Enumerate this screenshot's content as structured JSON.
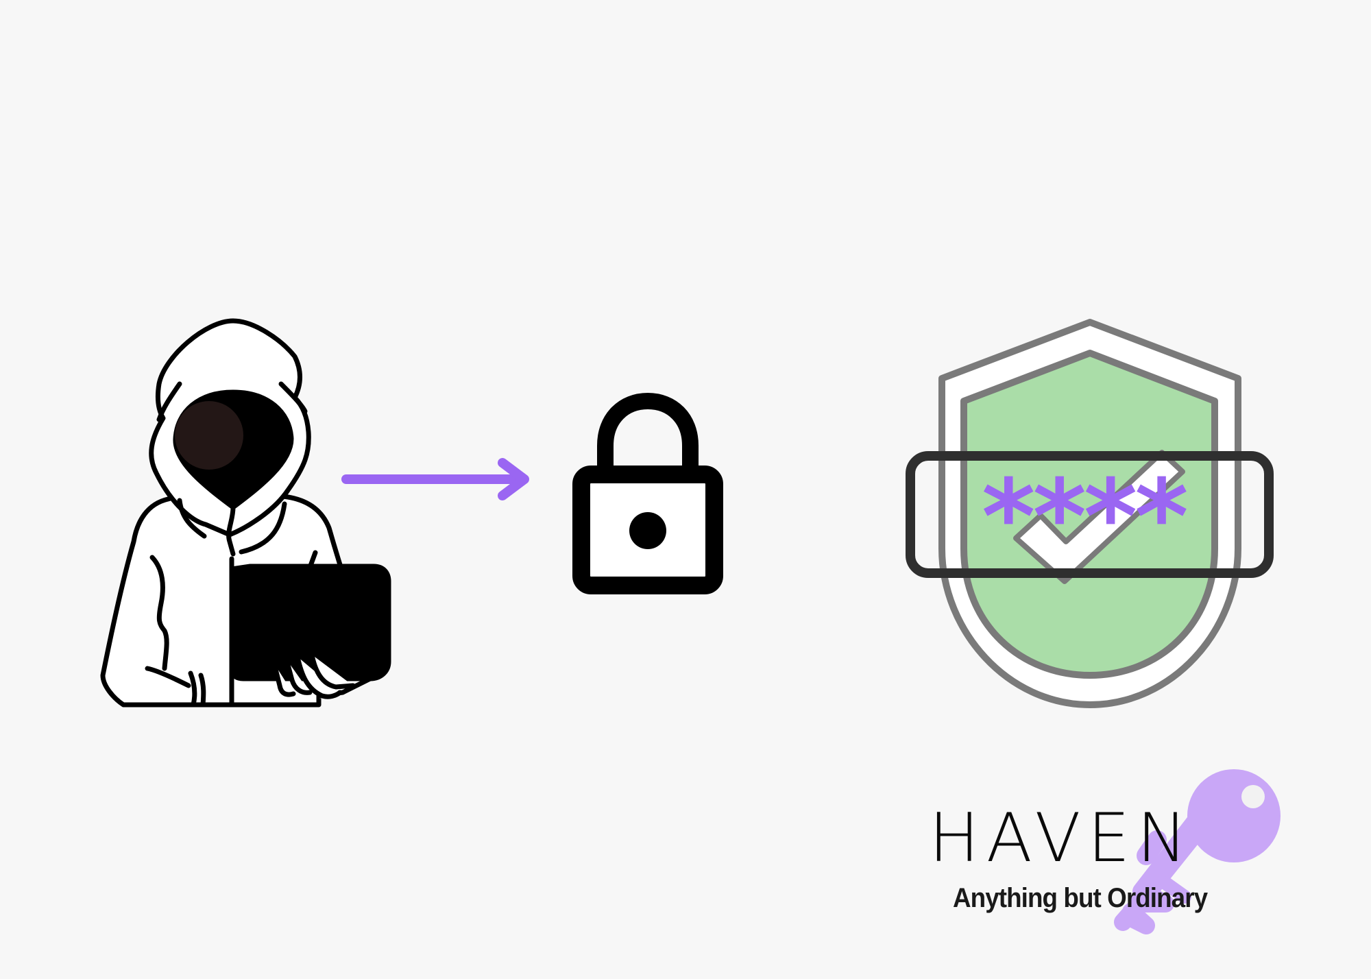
{
  "brand": {
    "name": "HAVEN",
    "tagline": "Anything but Ordinary"
  },
  "password_field": {
    "masked_value": "****"
  },
  "icons": {
    "hacker": "hooded-hacker-with-laptop-icon",
    "arrow": "arrow-right-icon",
    "lock": "padlock-icon",
    "shield": "shield-check-icon",
    "key": "key-icon"
  },
  "colors": {
    "background": "#f7f7f7",
    "accent_purple": "#9a66f2",
    "key_purple": "#c9a7f7",
    "shield_green": "#aadda8",
    "shield_outline": "#7a7a7a",
    "ink": "#0a0a0a"
  }
}
